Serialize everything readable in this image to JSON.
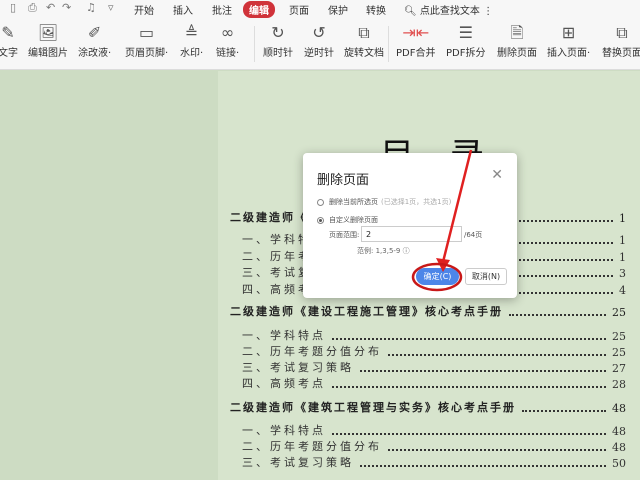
{
  "tabs": [
    "开始",
    "插入",
    "批注",
    "编辑",
    "页面",
    "保护",
    "转换"
  ],
  "active_tab": "编辑",
  "search_label": "点此查找文本",
  "toolbar": [
    {
      "label": "文字",
      "icon": "edit-text-icon"
    },
    {
      "label": "编辑图片",
      "icon": "edit-image-icon"
    },
    {
      "label": "涂改液·",
      "icon": "correction-pen-icon"
    },
    {
      "label": "页眉页脚·",
      "icon": "header-footer-icon"
    },
    {
      "label": "水印·",
      "icon": "watermark-icon"
    },
    {
      "label": "链接·",
      "icon": "link-icon"
    },
    {
      "label": "顺时针",
      "icon": "rotate-cw-icon"
    },
    {
      "label": "逆时针",
      "icon": "rotate-ccw-icon"
    },
    {
      "label": "旋转文档",
      "icon": "rotate-doc-icon"
    },
    {
      "label": "PDF合并",
      "icon": "pdf-merge-icon"
    },
    {
      "label": "PDF拆分",
      "icon": "pdf-split-icon"
    },
    {
      "label": "删除页面",
      "icon": "delete-page-icon"
    },
    {
      "label": "插入页面·",
      "icon": "insert-page-icon"
    },
    {
      "label": "替换页面",
      "icon": "replace-page-icon"
    }
  ],
  "document": {
    "title": "目录",
    "rows": [
      {
        "type": "h",
        "text": "二级建造师《",
        "page": "1"
      },
      {
        "type": "s",
        "text": "一、学科特",
        "page": "1"
      },
      {
        "type": "s",
        "text": "二、历年考",
        "page": "1"
      },
      {
        "type": "s",
        "text": "三、考试复",
        "page": "3"
      },
      {
        "type": "s",
        "text": "四、高频考",
        "page": "4"
      },
      {
        "type": "h",
        "text": "二级建造师《建设工程施工管理》核心考点手册",
        "page": "25"
      },
      {
        "type": "s",
        "text": "一、学科特点",
        "page": "25"
      },
      {
        "type": "s",
        "text": "二、历年考题分值分布",
        "page": "25"
      },
      {
        "type": "s",
        "text": "三、考试复习策略",
        "page": "27"
      },
      {
        "type": "s",
        "text": "四、高频考点",
        "page": "28"
      },
      {
        "type": "h",
        "text": "二级建造师《建筑工程管理与实务》核心考点手册",
        "page": "48"
      },
      {
        "type": "s",
        "text": "一、学科特点",
        "page": "48"
      },
      {
        "type": "s",
        "text": "二、历年考题分值分布",
        "page": "48"
      },
      {
        "type": "s",
        "text": "三、考试复习策略",
        "page": "50"
      }
    ]
  },
  "dialog": {
    "title": "删除页面",
    "option1": "删除当前所选页",
    "option1_hint": "(已选择1页，共选1页)",
    "option2": "自定义删除页面",
    "range_label": "页面范围:",
    "range_value": "2",
    "total": "/64页",
    "example": "范例: 1,3,5-9",
    "ok": "确定(C)",
    "cancel": "取消(N)"
  },
  "annotation_color": "#e02020"
}
